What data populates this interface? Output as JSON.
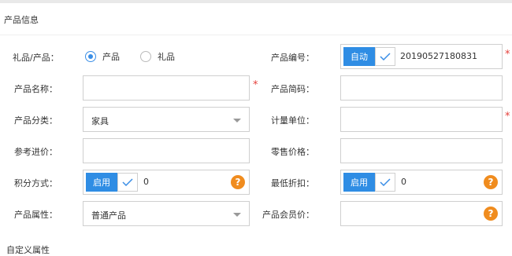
{
  "section": {
    "title": "产品信息",
    "footer_title": "自定义属性"
  },
  "form": {
    "type": {
      "label": "礼品/产品：",
      "options": [
        {
          "label": "产品",
          "selected": true
        },
        {
          "label": "礼品",
          "selected": false
        }
      ]
    },
    "product_code": {
      "label": "产品编号：",
      "toggle_label": "自动",
      "value": "20190527180831",
      "required": "*"
    },
    "product_name": {
      "label": "产品名称：",
      "value": "",
      "required": "*"
    },
    "short_code": {
      "label": "产品简码：",
      "value": ""
    },
    "category": {
      "label": "产品分类：",
      "value": "家具"
    },
    "unit": {
      "label": "计量单位：",
      "value": "",
      "required": "*"
    },
    "ref_price": {
      "label": "参考进价：",
      "value": ""
    },
    "retail_price": {
      "label": "零售价格：",
      "value": ""
    },
    "points_mode": {
      "label": "积分方式：",
      "toggle_label": "启用",
      "value": "0",
      "help": "?"
    },
    "min_discount": {
      "label": "最低折扣：",
      "toggle_label": "启用",
      "value": "0",
      "help": "?"
    },
    "attribute": {
      "label": "产品属性：",
      "value": "普通产品"
    },
    "member_price": {
      "label": "产品会员价：",
      "value": "",
      "help": "?"
    }
  },
  "colors": {
    "accent": "#2f8de4",
    "required": "#e5403b",
    "help": "#f08c1e"
  }
}
